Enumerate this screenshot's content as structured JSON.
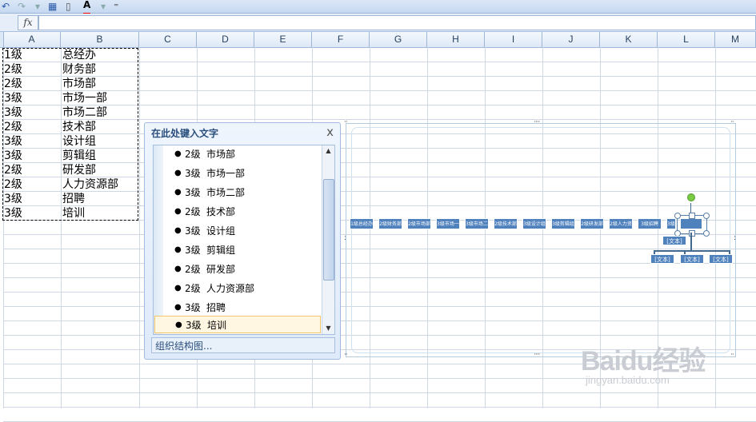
{
  "formula_bar": {
    "fx_label": "fx",
    "value": ""
  },
  "columns": [
    "A",
    "B",
    "C",
    "D",
    "E",
    "F",
    "G",
    "H",
    "I",
    "J",
    "K",
    "L",
    "M"
  ],
  "rows": [
    {
      "level": "1级",
      "name": "总经办"
    },
    {
      "level": "2级",
      "name": "财务部"
    },
    {
      "level": "2级",
      "name": "市场部"
    },
    {
      "level": "3级",
      "name": "市场一部"
    },
    {
      "level": "3级",
      "name": "市场二部"
    },
    {
      "level": "2级",
      "name": "技术部"
    },
    {
      "level": "3级",
      "name": "设计组"
    },
    {
      "level": "3级",
      "name": "剪辑组"
    },
    {
      "level": "2级",
      "name": "研发部"
    },
    {
      "level": "2级",
      "name": "人力资源部"
    },
    {
      "level": "3级",
      "name": "招聘"
    },
    {
      "level": "3级",
      "name": "培训"
    }
  ],
  "text_pane": {
    "title": "在此处键入文字",
    "close_label": "x",
    "items": [
      {
        "level": "2级",
        "name": "市场部"
      },
      {
        "level": "3级",
        "name": "市场一部"
      },
      {
        "level": "3级",
        "name": "市场二部"
      },
      {
        "level": "2级",
        "name": "技术部"
      },
      {
        "level": "3级",
        "name": "设计组"
      },
      {
        "level": "3级",
        "name": "剪辑组"
      },
      {
        "level": "2级",
        "name": "研发部"
      },
      {
        "level": "2级",
        "name": "人力资源部"
      },
      {
        "level": "3级",
        "name": "招聘"
      },
      {
        "level": "3级",
        "name": "培训"
      }
    ],
    "footer_label": "组织结构图..."
  },
  "smartart": {
    "node_labels": [
      "1级总经办",
      "2级财务部",
      "2级市场部",
      "3级市场一部",
      "3级市场二部",
      "2级技术部",
      "3级设计组",
      "3级剪辑组",
      "2级研发部",
      "2级人力资源部",
      "3级招聘",
      "3级培训"
    ],
    "text_placeholder": "[文本]"
  },
  "watermark": {
    "main": "Baidu经验",
    "sub": "jingyan.baidu.com"
  },
  "colors": {
    "node_fill": "#4f81bd",
    "grid_line": "#d0d7e5",
    "header_bg": "#dde8f6"
  }
}
